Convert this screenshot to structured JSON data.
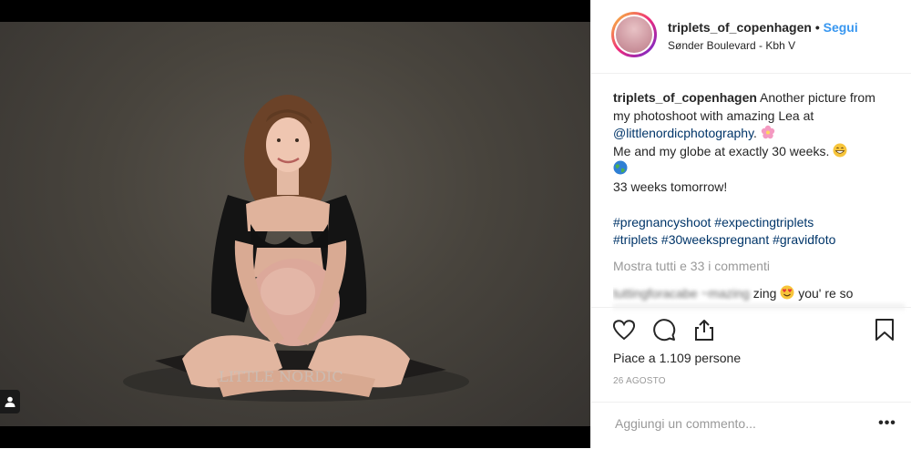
{
  "post": {
    "username": "triplets_of_copenhagen",
    "separator": "•",
    "follow_label": "Segui",
    "location": "Sønder Boulevard - Kbh V"
  },
  "photo": {
    "watermark": "LITTLE NORDIC"
  },
  "caption": {
    "username": "triplets_of_copenhagen",
    "text1": " Another picture from my photoshoot with amazing Lea at ",
    "mention": "@littlenordicphotography",
    "text2": ".",
    "line2": "Me and my globe at exactly 30 weeks.",
    "line3": "33 weeks tomorrow!",
    "hashtags_line1": "#pregnancyshoot #expectingtriplets",
    "hashtags_line2": "#triplets #30weekspregnant #gravidfoto"
  },
  "comments": {
    "show_all": "Mostra tutti e 33 i commenti",
    "preview_user": "tuttingforacabe ~mazing",
    "preview_text": "zing",
    "preview_text2": "you' re so"
  },
  "actions": {
    "likes": "Piace a 1.109 persone",
    "date": "26 AGOSTO"
  },
  "comment_box": {
    "placeholder": "Aggiungi un commento...",
    "more": "•••"
  },
  "colors": {
    "accent": "#3897f0",
    "link": "#003569",
    "muted": "#999999",
    "text": "#262626"
  }
}
